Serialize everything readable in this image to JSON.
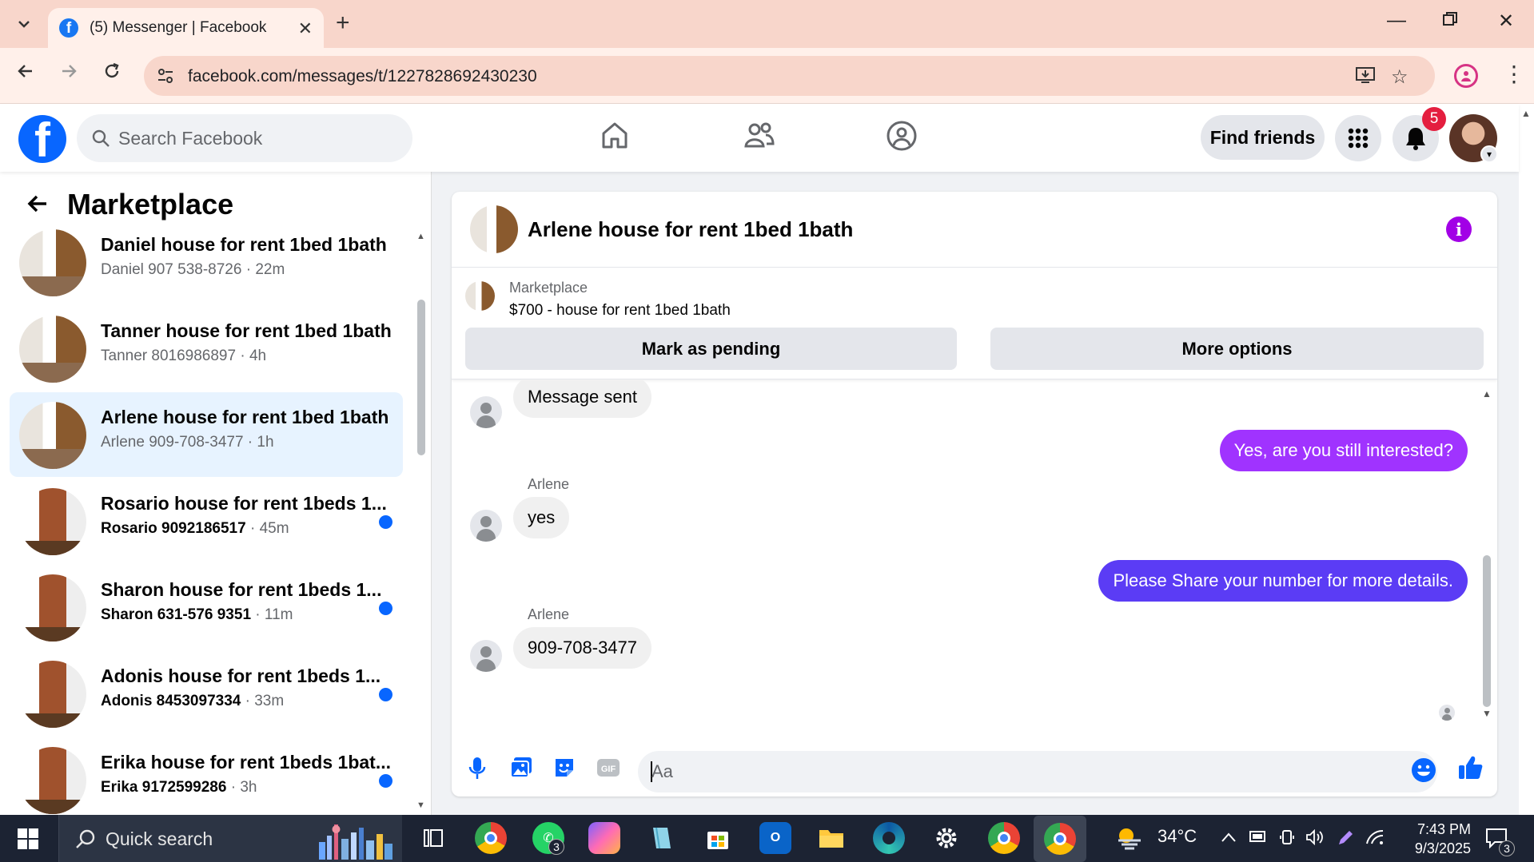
{
  "browser": {
    "tab_title": "(5) Messenger | Facebook",
    "url": "facebook.com/messages/t/1227828692430230"
  },
  "fb_header": {
    "search_placeholder": "Search Facebook",
    "find_friends_label": "Find friends",
    "notification_count": "5",
    "icons": [
      "home-icon",
      "friends-icon",
      "groups-icon",
      "menu-grid-icon",
      "bell-icon"
    ]
  },
  "left_panel": {
    "title": "Marketplace",
    "conversations": [
      {
        "title": "Daniel house for rent 1bed 1bath",
        "who": "Daniel 907 538-8726",
        "time": "22m",
        "unread": false,
        "active": false
      },
      {
        "title": "Tanner house for rent 1bed 1bath",
        "who": "Tanner 8016986897",
        "time": "4h",
        "unread": false,
        "active": false
      },
      {
        "title": "Arlene house for rent 1bed 1bath",
        "who": "Arlene 909-708-3477",
        "time": "1h",
        "unread": false,
        "active": true
      },
      {
        "title": "Rosario house for rent 1beds 1...",
        "who": "Rosario 9092186517",
        "time": "45m",
        "unread": true,
        "active": false
      },
      {
        "title": "Sharon house for rent 1beds 1...",
        "who": "Sharon 631-576 9351",
        "time": "11m",
        "unread": true,
        "active": false
      },
      {
        "title": "Adonis house for rent 1beds 1...",
        "who": "Adonis 8453097334",
        "time": "33m",
        "unread": true,
        "active": false
      },
      {
        "title": "Erika house for rent 1beds 1bat...",
        "who": "Erika 9172599286",
        "time": "3h",
        "unread": true,
        "active": false
      }
    ]
  },
  "chat": {
    "title": "Arlene house for rent 1bed 1bath",
    "marketplace_label": "Marketplace",
    "listing": "$700 - house for rent 1bed 1bath",
    "mark_pending_label": "Mark as pending",
    "more_options_label": "More options",
    "messages": [
      {
        "dir": "in",
        "sender": "",
        "text": "Message sent"
      },
      {
        "dir": "out",
        "text": "Yes, are you still interested?",
        "color": "#a033ff"
      },
      {
        "dir": "in",
        "sender": "Arlene",
        "text": "yes"
      },
      {
        "dir": "out",
        "text": "Please Share your number for more details.",
        "color": "#5b3cf5"
      },
      {
        "dir": "in",
        "sender": "Arlene",
        "text": "909-708-3477"
      }
    ],
    "composer_placeholder": "Aa",
    "accent_color": "#a200e6"
  },
  "taskbar": {
    "search_label": "Quick search",
    "weather": "34°C",
    "time": "7:43 PM",
    "date": "9/3/2025",
    "whatsapp_badge": "3",
    "notif_badge": "3"
  }
}
